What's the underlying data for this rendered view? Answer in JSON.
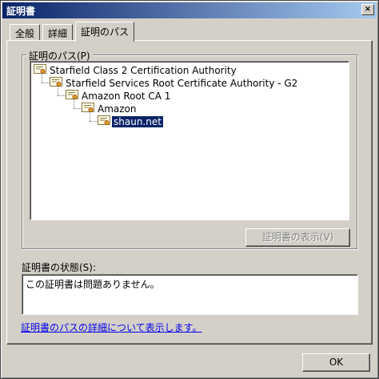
{
  "window": {
    "title": "証明書",
    "close_glyph": "×"
  },
  "tabs": [
    {
      "label": "全般"
    },
    {
      "label": "詳細"
    },
    {
      "label": "証明のパス",
      "active": true
    }
  ],
  "path_group": {
    "label": "証明のパス(P)",
    "nodes": [
      {
        "label": "Starfield Class 2 Certification Authority",
        "level": 0
      },
      {
        "label": "Starfield Services Root Certificate Authority - G2",
        "level": 1
      },
      {
        "label": "Amazon Root CA 1",
        "level": 2
      },
      {
        "label": "Amazon",
        "level": 3
      },
      {
        "label": "shaun.net",
        "level": 4,
        "selected": true
      }
    ],
    "view_button": "証明書の表示(V)"
  },
  "status": {
    "label": "証明書の状態(S):",
    "text": "この証明書は問題ありません。"
  },
  "link": {
    "text": "証明書のパスの詳細について表示します。"
  },
  "ok_button": "OK",
  "colors": {
    "face": "#d4d0c8",
    "title_start": "#0a246a",
    "title_end": "#a6caf0",
    "selection": "#0a246a",
    "link": "#0000ee"
  },
  "icons": {
    "certificate": "certificate-icon"
  }
}
